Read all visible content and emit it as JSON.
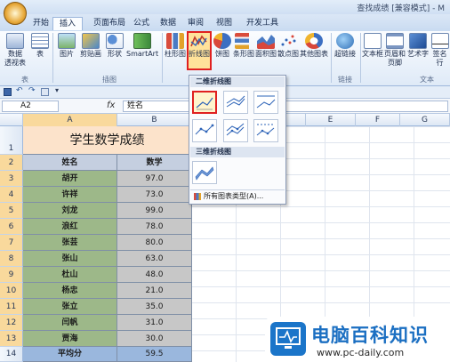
{
  "window": {
    "title": "查找成绩 [兼容模式] - M"
  },
  "tabs": [
    "开始",
    "插入",
    "页面布局",
    "公式",
    "数据",
    "审阅",
    "视图",
    "开发工具"
  ],
  "active_tab": "插入",
  "ribbon": {
    "buttons": [
      "数据\n透视表",
      "表",
      "图片",
      "剪贴画",
      "形状",
      "SmartArt",
      "柱形图",
      "折线图",
      "饼图",
      "条形图",
      "面积图",
      "散点图",
      "其他图表",
      "超链接",
      "文本框",
      "页眉和\n页脚",
      "艺术字",
      "签名行"
    ],
    "groups": [
      "表",
      "插图",
      "链接",
      "文本"
    ]
  },
  "formula_bar": {
    "name_box": "A2",
    "fx": "fx",
    "value": "姓名"
  },
  "columns": [
    "A",
    "B",
    "C",
    "D",
    "E",
    "F",
    "G"
  ],
  "rows": [
    "1",
    "2",
    "3",
    "4",
    "5",
    "6",
    "7",
    "8",
    "9",
    "10",
    "11",
    "12",
    "13",
    "14"
  ],
  "sheet": {
    "title": "学生数学成绩",
    "header": [
      "姓名",
      "数学"
    ],
    "records": [
      [
        "胡开",
        "97.0"
      ],
      [
        "许祥",
        "73.0"
      ],
      [
        "刘龙",
        "99.0"
      ],
      [
        "浪红",
        "78.0"
      ],
      [
        "张芸",
        "80.0"
      ],
      [
        "张山",
        "63.0"
      ],
      [
        "杜山",
        "48.0"
      ],
      [
        "杨忠",
        "21.0"
      ],
      [
        "张立",
        "35.0"
      ],
      [
        "闫帆",
        "31.0"
      ],
      [
        "贾海",
        "30.0"
      ]
    ],
    "footer": [
      "平均分",
      "59.5"
    ]
  },
  "dropdown": {
    "section_2d": "二维折线图",
    "section_3d": "三维折线图",
    "all_types": "所有图表类型(A)..."
  },
  "watermark": {
    "brand": "电脑百科知识",
    "url": "www.pc-daily.com"
  },
  "colors": {
    "title_fill": "#fce3cb",
    "header_fill": "#c5cfe0",
    "name_fill": "#9db889",
    "score_fill": "#c7c7c7",
    "footer_fill": "#9ab7dd",
    "highlight": "#e02020"
  }
}
